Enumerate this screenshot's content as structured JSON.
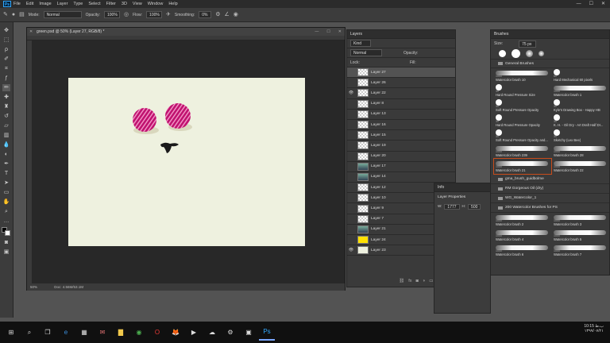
{
  "menubar": {
    "logo": "Ps",
    "items": [
      "File",
      "Edit",
      "Image",
      "Layer",
      "Type",
      "Select",
      "Filter",
      "3D",
      "View",
      "Window",
      "Help"
    ],
    "window_controls": [
      "—",
      "☐",
      "✕"
    ]
  },
  "options": {
    "mode_label": "Mode:",
    "mode_value": "Normal",
    "opacity_label": "Opacity:",
    "opacity_value": "100%",
    "flow_label": "Flow:",
    "flow_value": "100%",
    "smoothing_label": "Smoothing:",
    "smoothing_value": "0%"
  },
  "tools": [
    "move-tool",
    "marquee-tool",
    "lasso-tool",
    "quick-select-tool",
    "crop-tool",
    "eyedropper-tool",
    "brush-tool",
    "healing-tool",
    "clone-stamp-tool",
    "history-brush-tool",
    "eraser-tool",
    "gradient-tool",
    "blur-tool",
    "dodge-tool",
    "pen-tool",
    "type-tool",
    "path-select-tool",
    "shape-tool",
    "hand-tool",
    "zoom-tool"
  ],
  "document": {
    "tab_title": "green.psd @ 50% (Layer 27, RGB/8) *",
    "zoom": "50%",
    "doc_info": "Doc: 4.56M/53.1M"
  },
  "layers": {
    "title": "Layers",
    "kind_label": "Kind",
    "mode_value": "Normal",
    "opacity_label": "Opacity:",
    "fill_label": "Fill:",
    "lock_label": "Lock:",
    "rows": [
      {
        "name": "Layer 27",
        "visible": false,
        "selected": true,
        "thumb": "checker"
      },
      {
        "name": "Layer 26",
        "visible": false,
        "thumb": "checker"
      },
      {
        "name": "Layer 22",
        "visible": true,
        "thumb": "checker"
      },
      {
        "name": "Layer 8",
        "visible": false,
        "thumb": "checker"
      },
      {
        "name": "Layer 13",
        "visible": false,
        "thumb": "checker"
      },
      {
        "name": "Layer 16",
        "visible": false,
        "thumb": "checker"
      },
      {
        "name": "Layer 15",
        "visible": false,
        "thumb": "checker"
      },
      {
        "name": "Layer 19",
        "visible": false,
        "thumb": "checker"
      },
      {
        "name": "Layer 20",
        "visible": false,
        "thumb": "checker"
      },
      {
        "name": "Layer 17",
        "visible": false,
        "thumb": "image"
      },
      {
        "name": "Layer 14",
        "visible": false,
        "thumb": "image"
      },
      {
        "name": "Layer 12",
        "visible": false,
        "thumb": "checker"
      },
      {
        "name": "Layer 10",
        "visible": false,
        "thumb": "checker"
      },
      {
        "name": "Layer 9",
        "visible": false,
        "thumb": "checker"
      },
      {
        "name": "Layer 7",
        "visible": false,
        "thumb": "checker"
      },
      {
        "name": "Layer 21",
        "visible": false,
        "thumb": "image"
      },
      {
        "name": "Layer 24",
        "visible": false,
        "thumb": "yellow"
      },
      {
        "name": "Layer 23",
        "visible": true,
        "thumb": "cream"
      }
    ],
    "footer_icons": [
      "link-icon",
      "fx-icon",
      "mask-icon",
      "adjustment-icon",
      "group-icon",
      "new-layer-icon",
      "trash-icon"
    ]
  },
  "brushes": {
    "title": "Brushes",
    "size_label": "Size:",
    "size_value": "75 px",
    "general_group": "General Brushes",
    "general": [
      {
        "name": "Watercolor brush 10",
        "size": "1000"
      },
      {
        "name": "Hard Mechanical 60 pixels",
        "size": "60"
      },
      {
        "name": "Hard Round Pressure Size",
        "size": "30"
      },
      {
        "name": "Watercolor brush 1",
        "size": "1000"
      },
      {
        "name": "Soft Round Pressure Opacity",
        "size": "30"
      },
      {
        "name": "Kyle's Drawing Box - Happy HB",
        "size": "30"
      },
      {
        "name": "Hard Round Pressure Opacity",
        "size": "30"
      },
      {
        "name": "K. H. - Oil Dry - Art Draft Half Dr...",
        "size": "30"
      },
      {
        "name": "Soft Round Pressure Opacity and...",
        "size": "30"
      },
      {
        "name": "Sketchy (Lex Bee)",
        "size": "30"
      },
      {
        "name": "Watercolor brush 239",
        "size": "1000"
      },
      {
        "name": "Watercolor brush 28",
        "size": "1000"
      },
      {
        "name": "Watercolor brush 21",
        "size": "1000",
        "selected": true
      },
      {
        "name": "Watercolor brush 22",
        "size": "1000"
      }
    ],
    "folders": [
      "gma_brush_guidbolme",
      "RM Gorgeous Oil (dry)",
      "WG_Watercolor_1",
      "200 Watercolor Brushes for PS"
    ],
    "watercolor": [
      {
        "name": "Watercolor brush 2",
        "size": "1000"
      },
      {
        "name": "Watercolor brush 3",
        "size": "1000"
      },
      {
        "name": "Watercolor brush 4",
        "size": "1000"
      },
      {
        "name": "Watercolor brush 5",
        "size": "1000"
      },
      {
        "name": "Watercolor brush 6",
        "size": "1000"
      },
      {
        "name": "Watercolor brush 7",
        "size": "1000"
      }
    ]
  },
  "properties": {
    "title": "Layer Properties",
    "info_tab": "Info",
    "w_label": "W:",
    "w_value": "1777",
    "h_label": "H:",
    "h_value": "500"
  },
  "taskbar": {
    "icons": [
      "windows-icon",
      "search-icon",
      "task-view-icon",
      "edge-icon",
      "calculator-icon",
      "mail-icon",
      "files-icon",
      "chrome-icon",
      "opera-icon",
      "firefox-icon",
      "media-icon",
      "cloud-icon",
      "settings-icon",
      "store-icon",
      "photoshop-icon"
    ],
    "time": "10:15 ب.ظ",
    "date": "۱۳۹۹/۰۷/۲۱"
  }
}
